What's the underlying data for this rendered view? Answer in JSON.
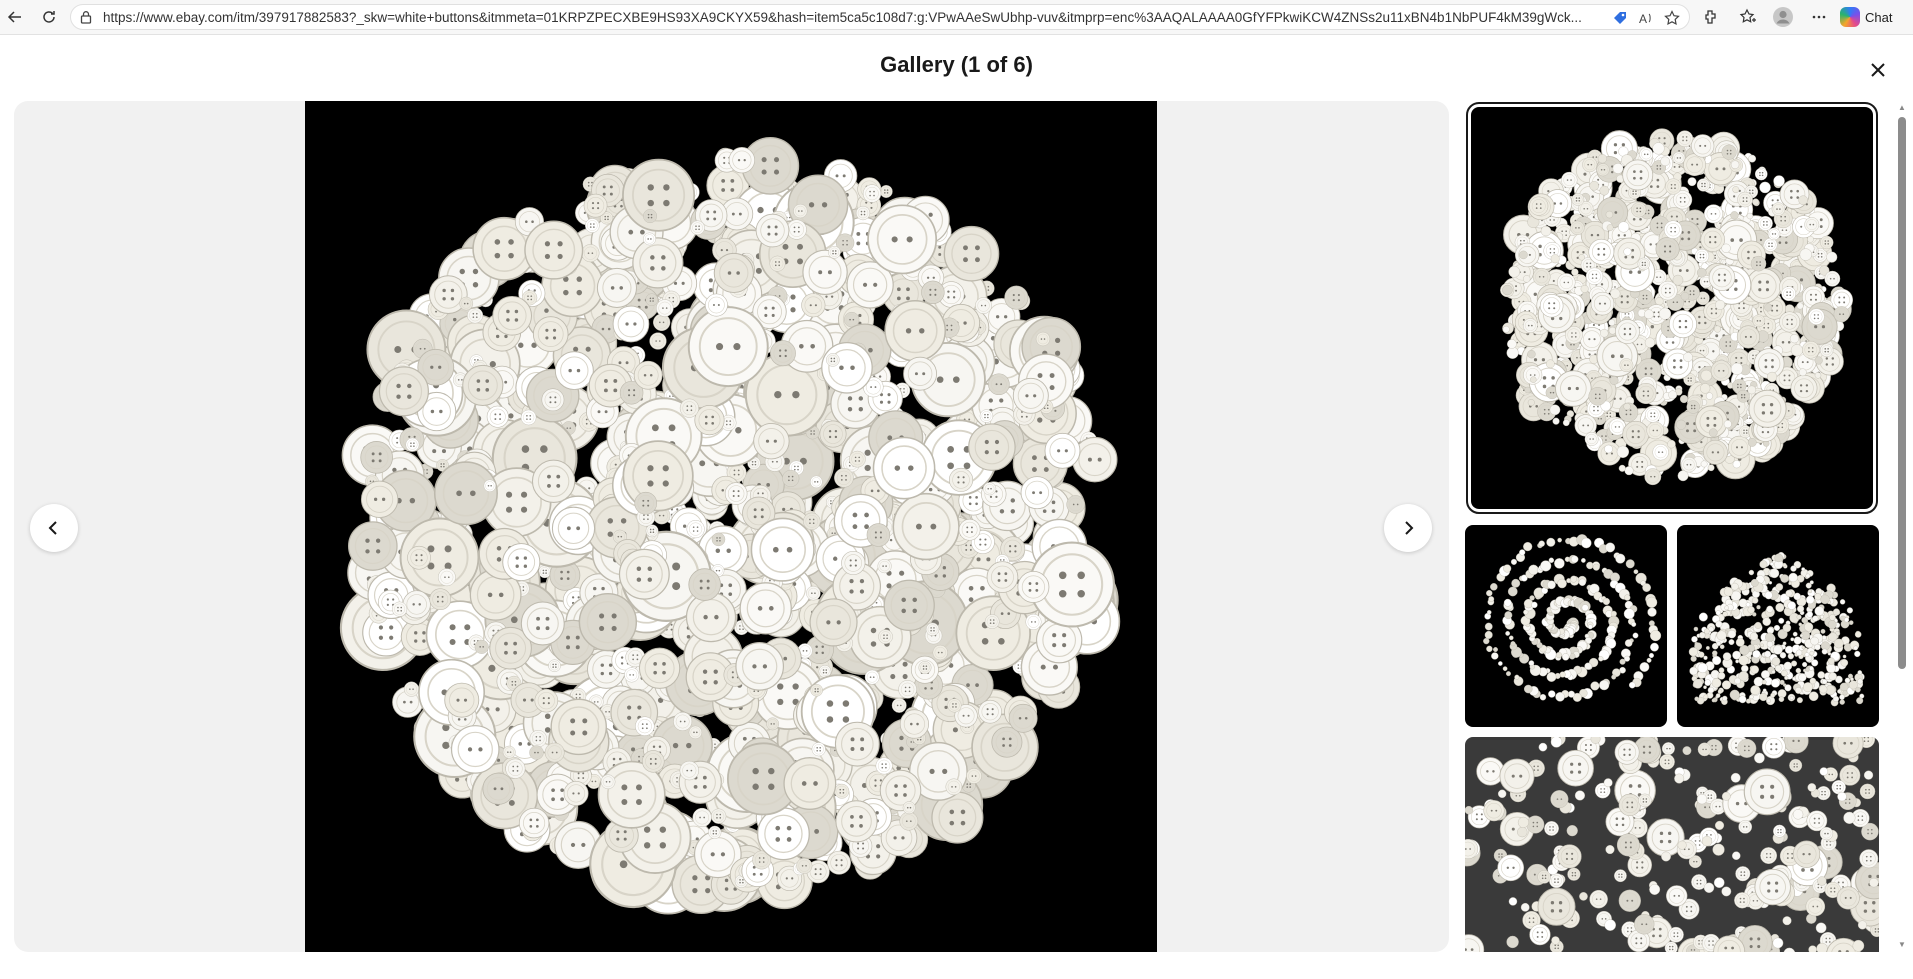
{
  "browser": {
    "url": "https://www.ebay.com/itm/397917882583?_skw=white+buttons&itmmeta=01KRPZPECXBE9HS93XA9CKYX59&hash=item5ca5c108d7:g:VPwAAeSwUbhp-vuv&itmprp=enc%3AAQALAAAA0GfYFPkwiKCW4ZNSs2u11xBN4b1NbPUF4kM39gWck...",
    "chat_label": "Chat"
  },
  "gallery": {
    "title": "Gallery (1 of 6)",
    "current_index": 1,
    "total": 6
  },
  "colors": {
    "viewer_bg": "#f1f1f1",
    "image_bg": "#000000",
    "selected_outline": "#191919"
  }
}
